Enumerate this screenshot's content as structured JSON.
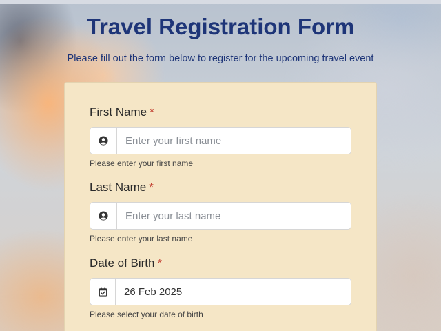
{
  "page": {
    "title": "Travel Registration Form",
    "subtitle": "Please fill out the form below to register for the upcoming travel event"
  },
  "form": {
    "fields": [
      {
        "label": "First Name",
        "required_mark": "*",
        "icon": "user-circle-icon",
        "value": "",
        "placeholder": "Enter your first name",
        "help": "Please enter your first name"
      },
      {
        "label": "Last Name",
        "required_mark": "*",
        "icon": "user-circle-icon",
        "value": "",
        "placeholder": "Enter your last name",
        "help": "Please enter your last name"
      },
      {
        "label": "Date of Birth",
        "required_mark": "*",
        "icon": "calendar-check-icon",
        "value": "26 Feb 2025",
        "placeholder": "",
        "help": "Please select your date of birth"
      }
    ]
  },
  "colors": {
    "title": "#1e3578",
    "card_background": "#f5e6c6",
    "required": "#c0392b"
  }
}
